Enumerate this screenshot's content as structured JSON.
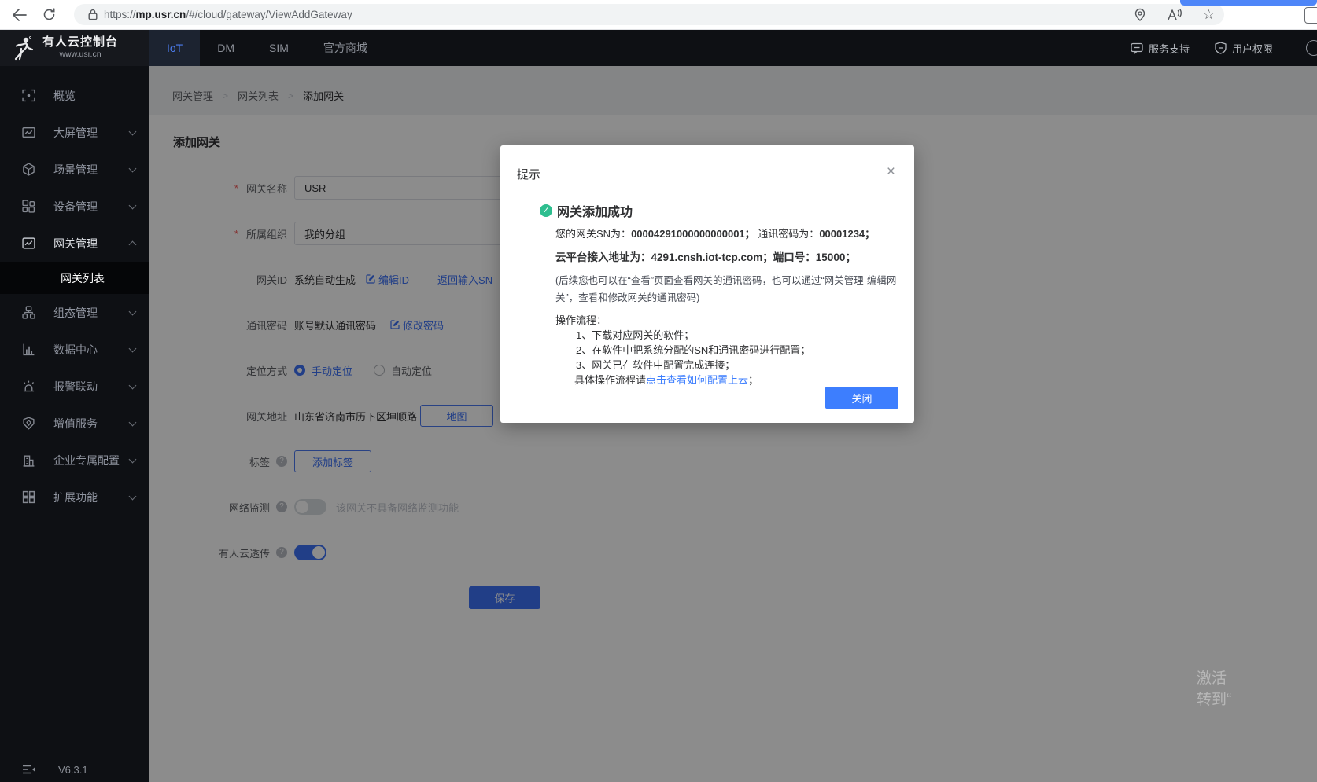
{
  "browser": {
    "url_scheme": "https://",
    "url_host": "mp.usr.cn",
    "url_path": "/#/cloud/gateway/ViewAddGateway"
  },
  "header": {
    "logo_title": "有人云控制台",
    "logo_subtitle": "www.usr.cn",
    "tabs": [
      {
        "label": "IoT"
      },
      {
        "label": "DM"
      },
      {
        "label": "SIM"
      },
      {
        "label": "官方商城"
      }
    ],
    "support_label": "服务支持",
    "permission_label": "用户权限"
  },
  "sidebar": {
    "items": [
      {
        "label": "概览"
      },
      {
        "label": "大屏管理"
      },
      {
        "label": "场景管理"
      },
      {
        "label": "设备管理"
      },
      {
        "label": "网关管理",
        "children": [
          {
            "label": "网关列表"
          }
        ]
      },
      {
        "label": "组态管理"
      },
      {
        "label": "数据中心"
      },
      {
        "label": "报警联动"
      },
      {
        "label": "增值服务"
      },
      {
        "label": "企业专属配置"
      },
      {
        "label": "扩展功能"
      }
    ],
    "version": "V6.3.1"
  },
  "breadcrumb": {
    "items": [
      "网关管理",
      "网关列表",
      "添加网关"
    ],
    "separator": ">"
  },
  "page": {
    "title": "添加网关"
  },
  "form": {
    "gateway_name": {
      "label": "网关名称",
      "value": "USR"
    },
    "organization": {
      "label": "所属组织",
      "value": "我的分组"
    },
    "gateway_id": {
      "label": "网关ID",
      "value": "系统自动生成",
      "edit_link": "编辑ID",
      "sn_link": "返回输入SN"
    },
    "comm_password": {
      "label": "通讯密码",
      "value": "账号默认通讯密码",
      "edit_link": "修改密码"
    },
    "location_mode": {
      "label": "定位方式",
      "option_manual": "手动定位",
      "option_auto": "自动定位"
    },
    "gateway_address": {
      "label": "网关地址",
      "value": "山东省济南市历下区坤顺路",
      "map_button": "地图"
    },
    "tags": {
      "label": "标签",
      "add_button": "添加标签"
    },
    "network_monitor": {
      "label": "网络监测",
      "hint": "该网关不具备网络监测功能"
    },
    "cloud_passthrough": {
      "label": "有人云透传"
    },
    "save_button": "保存"
  },
  "modal": {
    "title": "提示",
    "success_title": "网关添加成功",
    "line1_t1": "您的网关SN为：",
    "line1_b1": "00004291000000000001；",
    "line1_t2": "通讯密码为：",
    "line1_b2": "00001234；",
    "line2": "云平台接入地址为：4291.cnsh.iot-tcp.com；端口号：15000；",
    "note": "(后续您也可以在“查看”页面查看网关的通讯密码，也可以通过“网关管理-编辑网关”，查看和修改网关的通讯密码)",
    "flow_title": "操作流程：",
    "steps": [
      "1、下载对应网关的软件；",
      "2、在软件中把系统分配的SN和通讯密码进行配置；",
      "3、网关已在软件中配置完成连接；"
    ],
    "more_prefix": "具体操作流程请",
    "more_link": "点击查看如何配置上云",
    "more_suffix": "；",
    "close_button": "关闭"
  },
  "watermark": {
    "line1": "激活",
    "line2": "转到“"
  },
  "colors": {
    "accent_blue": "#3d72f6",
    "modal_button_blue": "#3d7efe",
    "success_green": "#2ebe8f",
    "active_tab_text": "#4c7df0",
    "header_dark": "#0e1014"
  }
}
